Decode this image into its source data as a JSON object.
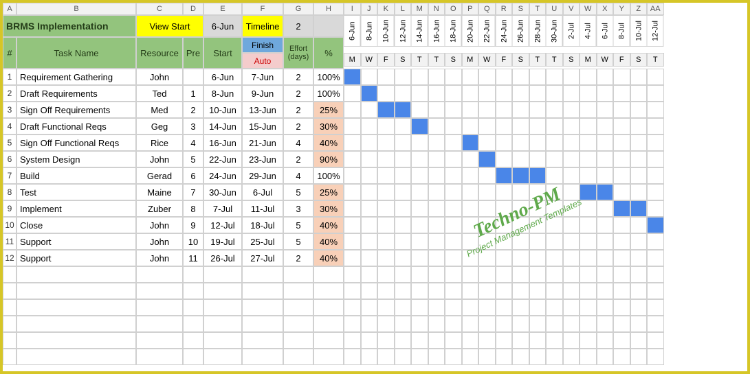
{
  "columns": [
    "A",
    "B",
    "C",
    "D",
    "E",
    "F",
    "G",
    "H",
    "I",
    "J",
    "K",
    "L",
    "M",
    "N",
    "O",
    "P",
    "Q",
    "R",
    "S",
    "T",
    "U",
    "V",
    "W",
    "X",
    "Y",
    "Z",
    "AA"
  ],
  "title": "BRMS Implementation",
  "topRow": {
    "viewStart": "View Start",
    "date": "6-Jun",
    "timeline": "Timeline",
    "period": "2"
  },
  "headers": {
    "num": "#",
    "task": "Task Name",
    "resource": "Resource",
    "pre": "Pre",
    "start": "Start",
    "finish": "Finish",
    "auto": "Auto",
    "effort": "Effort (days)",
    "pct": "%"
  },
  "dateHeaders": [
    "6-Jun",
    "8-Jun",
    "10-Jun",
    "12-Jun",
    "14-Jun",
    "16-Jun",
    "18-Jun",
    "20-Jun",
    "22-Jun",
    "24-Jun",
    "26-Jun",
    "28-Jun",
    "30-Jun",
    "2-Jul",
    "4-Jul",
    "6-Jul",
    "8-Jul",
    "10-Jul",
    "12-Jul"
  ],
  "dayHeaders": [
    "M",
    "W",
    "F",
    "S",
    "T",
    "T",
    "S",
    "M",
    "W",
    "F",
    "S",
    "T",
    "T",
    "S",
    "M",
    "W",
    "F",
    "S",
    "T"
  ],
  "rows": [
    {
      "n": "1",
      "task": "Requirement Gathering",
      "res": "John",
      "pre": "",
      "start": "6-Jun",
      "fin": "7-Jun",
      "eff": "2",
      "pct": "100%",
      "salmon": false,
      "bar": [
        0
      ]
    },
    {
      "n": "2",
      "task": "Draft  Requirements",
      "res": "Ted",
      "pre": "1",
      "start": "8-Jun",
      "fin": "9-Jun",
      "eff": "2",
      "pct": "100%",
      "salmon": false,
      "bar": [
        1
      ]
    },
    {
      "n": "3",
      "task": "Sign Off  Requirements",
      "res": "Med",
      "pre": "2",
      "start": "10-Jun",
      "fin": "13-Jun",
      "eff": "2",
      "pct": "25%",
      "salmon": true,
      "bar": [
        2,
        3
      ]
    },
    {
      "n": "4",
      "task": "Draft Functional Reqs",
      "res": "Geg",
      "pre": "3",
      "start": "14-Jun",
      "fin": "15-Jun",
      "eff": "2",
      "pct": "30%",
      "salmon": true,
      "bar": [
        4
      ]
    },
    {
      "n": "5",
      "task": "Sign Off Functional Reqs",
      "res": "Rice",
      "pre": "4",
      "start": "16-Jun",
      "fin": "21-Jun",
      "eff": "4",
      "pct": "40%",
      "salmon": true,
      "bar": [
        7
      ]
    },
    {
      "n": "6",
      "task": "System Design",
      "res": "John",
      "pre": "5",
      "start": "22-Jun",
      "fin": "23-Jun",
      "eff": "2",
      "pct": "90%",
      "salmon": true,
      "bar": [
        8
      ]
    },
    {
      "n": "7",
      "task": "Build",
      "res": "Gerad",
      "pre": "6",
      "start": "24-Jun",
      "fin": "29-Jun",
      "eff": "4",
      "pct": "100%",
      "salmon": false,
      "bar": [
        9,
        10,
        11
      ]
    },
    {
      "n": "8",
      "task": "Test",
      "res": "Maine",
      "pre": "7",
      "start": "30-Jun",
      "fin": "6-Jul",
      "eff": "5",
      "pct": "25%",
      "salmon": true,
      "bar": [
        14,
        15
      ]
    },
    {
      "n": "9",
      "task": "Implement",
      "res": "Zuber",
      "pre": "8",
      "start": "7-Jul",
      "fin": "11-Jul",
      "eff": "3",
      "pct": "30%",
      "salmon": true,
      "bar": [
        16,
        17
      ]
    },
    {
      "n": "10",
      "task": "Close",
      "res": "John",
      "pre": "9",
      "start": "12-Jul",
      "fin": "18-Jul",
      "eff": "5",
      "pct": "40%",
      "salmon": true,
      "bar": [
        18
      ]
    },
    {
      "n": "11",
      "task": "Support",
      "res": "John",
      "pre": "10",
      "start": "19-Jul",
      "fin": "25-Jul",
      "eff": "5",
      "pct": "40%",
      "salmon": true,
      "bar": []
    },
    {
      "n": "12",
      "task": "Support",
      "res": "John",
      "pre": "11",
      "start": "26-Jul",
      "fin": "27-Jul",
      "eff": "2",
      "pct": "40%",
      "salmon": true,
      "bar": []
    }
  ],
  "watermark": {
    "main": "Techno-PM",
    "sub": "Project Management Templates"
  }
}
